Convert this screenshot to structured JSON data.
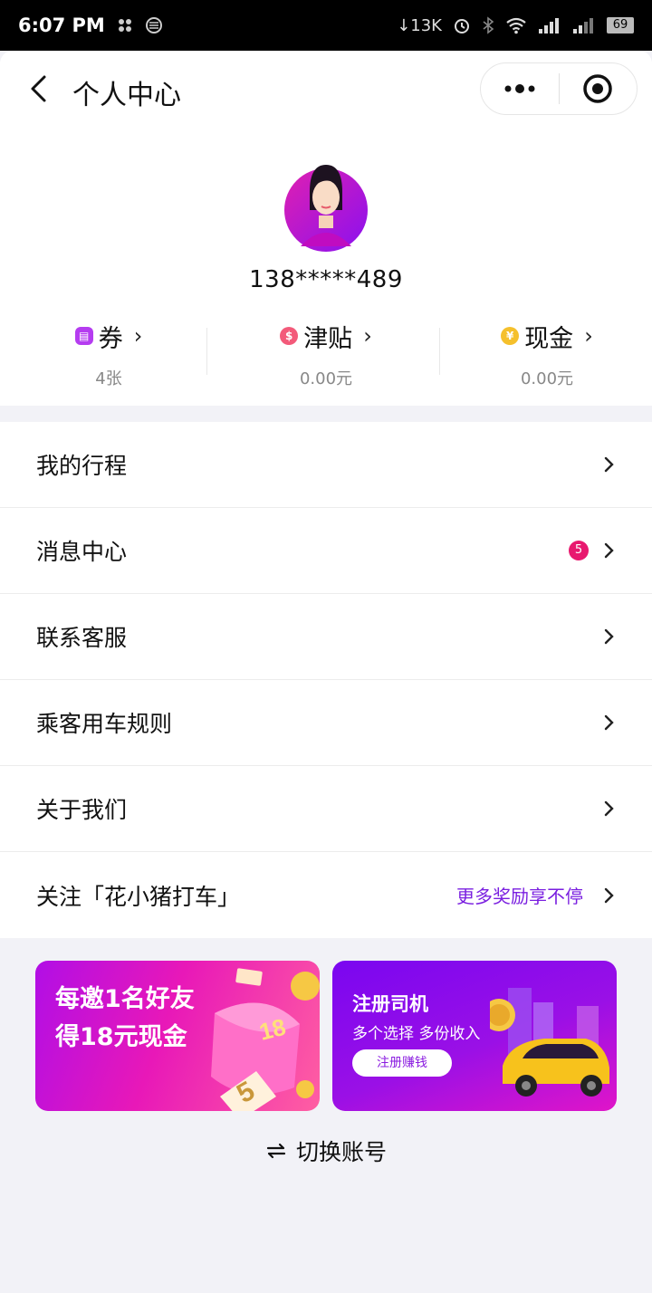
{
  "status_bar": {
    "time": "6:07 PM",
    "network_speed": "13K",
    "battery": "69"
  },
  "navbar": {
    "title": "个人中心"
  },
  "profile": {
    "phone": "138*****489"
  },
  "stats": [
    {
      "label": "券",
      "value": "4张",
      "icon": "coupon-icon",
      "color": "#b53cf0"
    },
    {
      "label": "津贴",
      "value": "0.00元",
      "icon": "allowance-icon",
      "color": "#f35a7a"
    },
    {
      "label": "现金",
      "value": "0.00元",
      "icon": "cash-icon",
      "color": "#f5c02c"
    }
  ],
  "menu": [
    {
      "label": "我的行程"
    },
    {
      "label": "消息中心",
      "badge": "5"
    },
    {
      "label": "联系客服"
    },
    {
      "label": "乘客用车规则"
    },
    {
      "label": "关于我们"
    },
    {
      "label": "关注「花小猪打车」",
      "extra": "更多奖励享不停"
    }
  ],
  "banners": {
    "invite": {
      "line1": "每邀1名好友",
      "line2": "得18元现金",
      "badge_number": "18",
      "ticket_number": "5"
    },
    "driver": {
      "title": "注册司机",
      "subtitle": "多个选择 多份收入",
      "button": "注册赚钱"
    }
  },
  "switch_account": {
    "label": "切换账号"
  },
  "colors": {
    "accent": "#7a1fe0",
    "badge": "#e8196f"
  }
}
